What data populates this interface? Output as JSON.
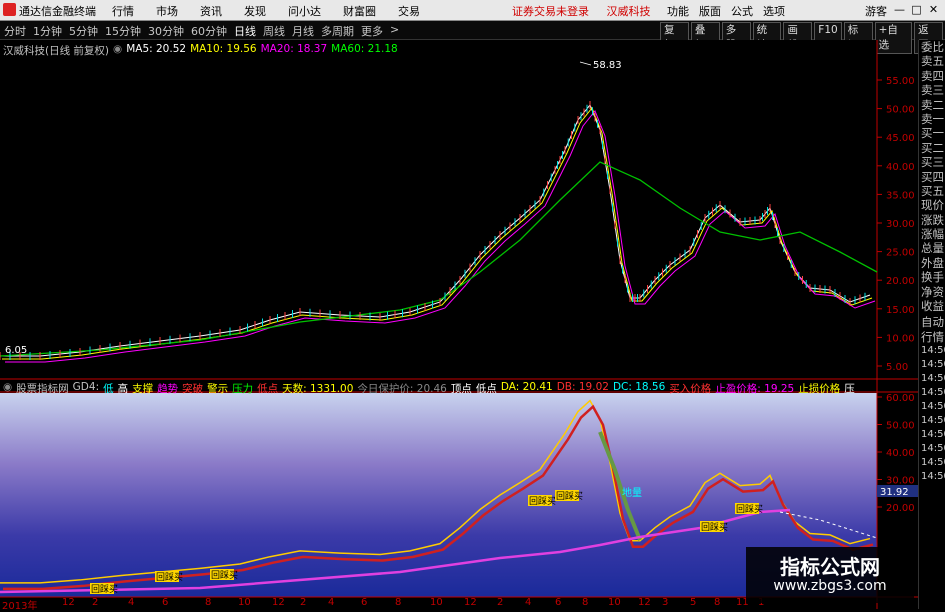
{
  "window": {
    "app_title": "通达信金融终端",
    "menus": [
      "行情",
      "市场",
      "资讯",
      "发现",
      "问小达",
      "财富圈",
      "交易"
    ],
    "notice": "证券交易未登录",
    "stock_name_title": "汉威科技",
    "right_menus": [
      "功能",
      "版面",
      "公式",
      "选项"
    ],
    "guest": "游客",
    "min_icon": "—",
    "max_icon": "□",
    "close_icon": "✕"
  },
  "toolbar": {
    "periods": [
      "分时",
      "1分钟",
      "5分钟",
      "15分钟",
      "30分钟",
      "60分钟",
      "日线",
      "周线",
      "月线",
      "多周期",
      "更多"
    ],
    "active_period": "日线",
    "tools": [
      "复权",
      "叠加",
      "多股",
      "统计",
      "画线",
      "F10",
      "标记",
      "+自选",
      "返回"
    ]
  },
  "price_chart": {
    "title": "汉威科技(日线 前复权)",
    "ma": [
      {
        "label": "MA5: 20.52",
        "color": "#ffffff"
      },
      {
        "label": "MA10: 19.56",
        "color": "#ffff00"
      },
      {
        "label": "MA20: 18.37",
        "color": "#ff00ff"
      },
      {
        "label": "MA60: 21.18",
        "color": "#00ff00"
      }
    ],
    "high_label": "58.83",
    "low_label": "6.05",
    "y_ticks": [
      "55.00",
      "50.00",
      "45.00",
      "40.00",
      "35.00",
      "30.00",
      "25.00",
      "20.00",
      "15.00",
      "10.00",
      "5.00"
    ],
    "axis_color": "#c00000"
  },
  "indicator_panel": {
    "name": "股票指标网",
    "items": [
      {
        "text": "GD4:",
        "color": "#c0c0c0"
      },
      {
        "text": "低",
        "color": "#00ffff"
      },
      {
        "text": "高",
        "color": "#ffffff"
      },
      {
        "text": "支撑",
        "color": "#ffff00"
      },
      {
        "text": "趋势",
        "color": "#ff00ff"
      },
      {
        "text": "突破",
        "color": "#ff3030"
      },
      {
        "text": "警示",
        "color": "#ffff00"
      },
      {
        "text": "压力",
        "color": "#00ff00"
      },
      {
        "text": "低点",
        "color": "#ff3030"
      },
      {
        "text": "天数: 1331.00",
        "color": "#ffff00"
      },
      {
        "text": "今日保护价: 20.46",
        "color": "#888888"
      },
      {
        "text": "顶点",
        "color": "#ffffff"
      },
      {
        "text": "低点",
        "color": "#ffffff"
      },
      {
        "text": "DA: 20.41",
        "color": "#ffff00"
      },
      {
        "text": "DB: 19.02",
        "color": "#ff3030"
      },
      {
        "text": "DC: 18.56",
        "color": "#00ffff"
      },
      {
        "text": "买入价格",
        "color": "#ff3030"
      },
      {
        "text": "止盈价格: 19.25",
        "color": "#ff00ff"
      },
      {
        "text": "止损价格",
        "color": "#ffff00"
      },
      {
        "text": "压",
        "color": "#ffffff"
      }
    ],
    "y_ticks": [
      "60.00",
      "50.00",
      "40.00",
      "30.00",
      "20.00"
    ],
    "current_value": "31.92",
    "buy_labels": [
      "回踩买",
      "回踩买",
      "回踩买",
      "回踩买",
      "回踩买",
      "回踩买",
      "回踩买"
    ],
    "warn_label": "地量"
  },
  "x_axis": {
    "labels": [
      "2013年",
      "12",
      "2",
      "4",
      "6",
      "8",
      "10",
      "12",
      "2",
      "4",
      "6",
      "8",
      "10",
      "12",
      "2",
      "4",
      "6",
      "8",
      "10",
      "12",
      "3",
      "5",
      "8",
      "11",
      "1"
    ]
  },
  "right_panel": {
    "tabs": [
      "委比",
      "卖五",
      "卖四",
      "卖三",
      "卖二",
      "卖一",
      "买一",
      "买二",
      "买三",
      "买四",
      "买五",
      "现价",
      "涨跌",
      "涨幅",
      "总量",
      "外盘",
      "换手",
      "净资",
      "收益"
    ],
    "tab2": [
      "自动",
      "行情"
    ],
    "times": [
      "14:50",
      "14:50",
      "14:50",
      "14:50",
      "14:50",
      "14:50",
      "14:50",
      "14:50",
      "14:50",
      "14:50"
    ]
  },
  "watermark": {
    "title": "指标公式网",
    "url": "www.zbgs3.com"
  }
}
